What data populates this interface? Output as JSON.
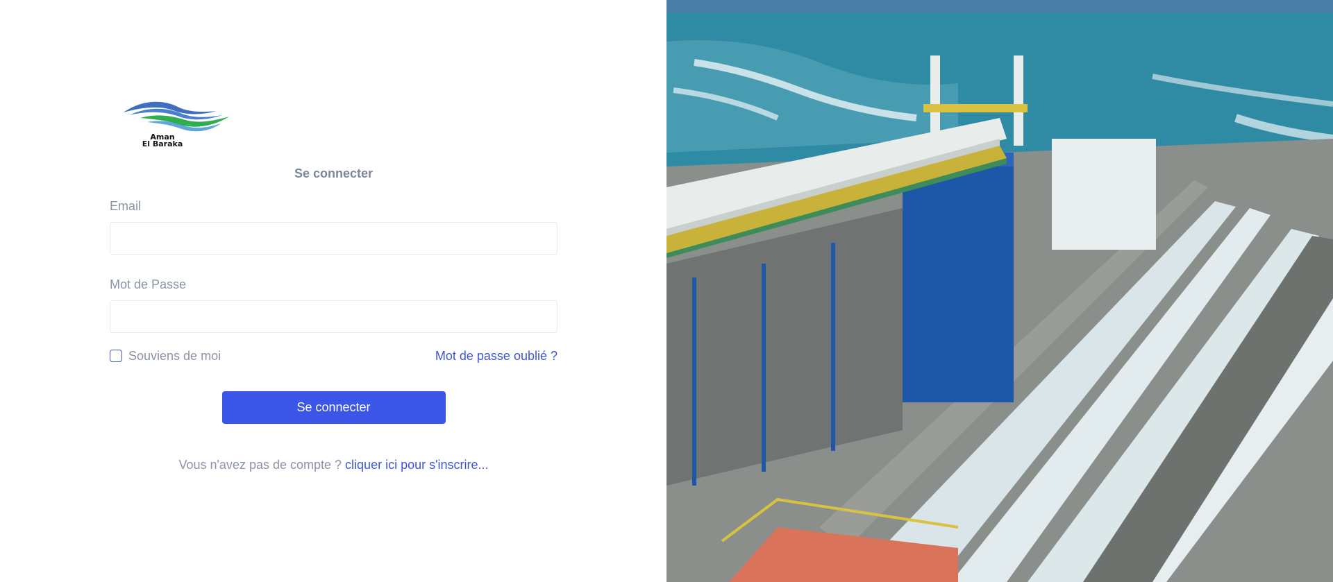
{
  "brand": {
    "logo_line1": "Aman",
    "logo_line2": "El Baraka",
    "colors": {
      "wave_blue": "#3f6fbf",
      "wave_green": "#2fae4f"
    }
  },
  "login": {
    "title": "Se connecter",
    "email_label": "Email",
    "email_value": "",
    "email_placeholder": "",
    "password_label": "Mot de Passe",
    "password_value": "",
    "password_placeholder": "",
    "remember_label": "Souviens de moi",
    "remember_checked": false,
    "forgot_link": "Mot de passe oublié ?",
    "submit_label": "Se connecter",
    "signup_prompt": "Vous n'avez pas de compte ?",
    "signup_link": "cliquer ici pour s'inscrire..."
  },
  "theme": {
    "accent": "#3a55e8",
    "link": "#3f55d6",
    "muted_text": "#8a93a6"
  }
}
